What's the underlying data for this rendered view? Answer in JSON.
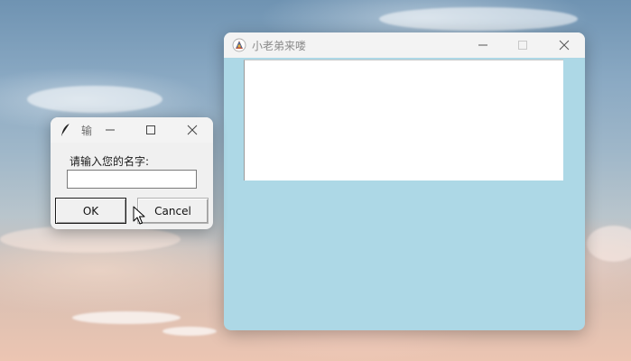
{
  "main_window": {
    "title": "小老弟来喽",
    "icon": "tk-feather-icon",
    "background_color": "#add8e6",
    "controls": [
      "minimize-icon",
      "maximize-icon",
      "close-icon"
    ]
  },
  "dialog": {
    "title": "输",
    "icon": "feather-icon",
    "prompt": "请输入您的名字:",
    "input_value": "",
    "ok_label": "OK",
    "cancel_label": "Cancel",
    "controls": [
      "minimize-icon",
      "maximize-icon",
      "close-icon"
    ]
  },
  "cursor": "arrow-cursor-icon"
}
